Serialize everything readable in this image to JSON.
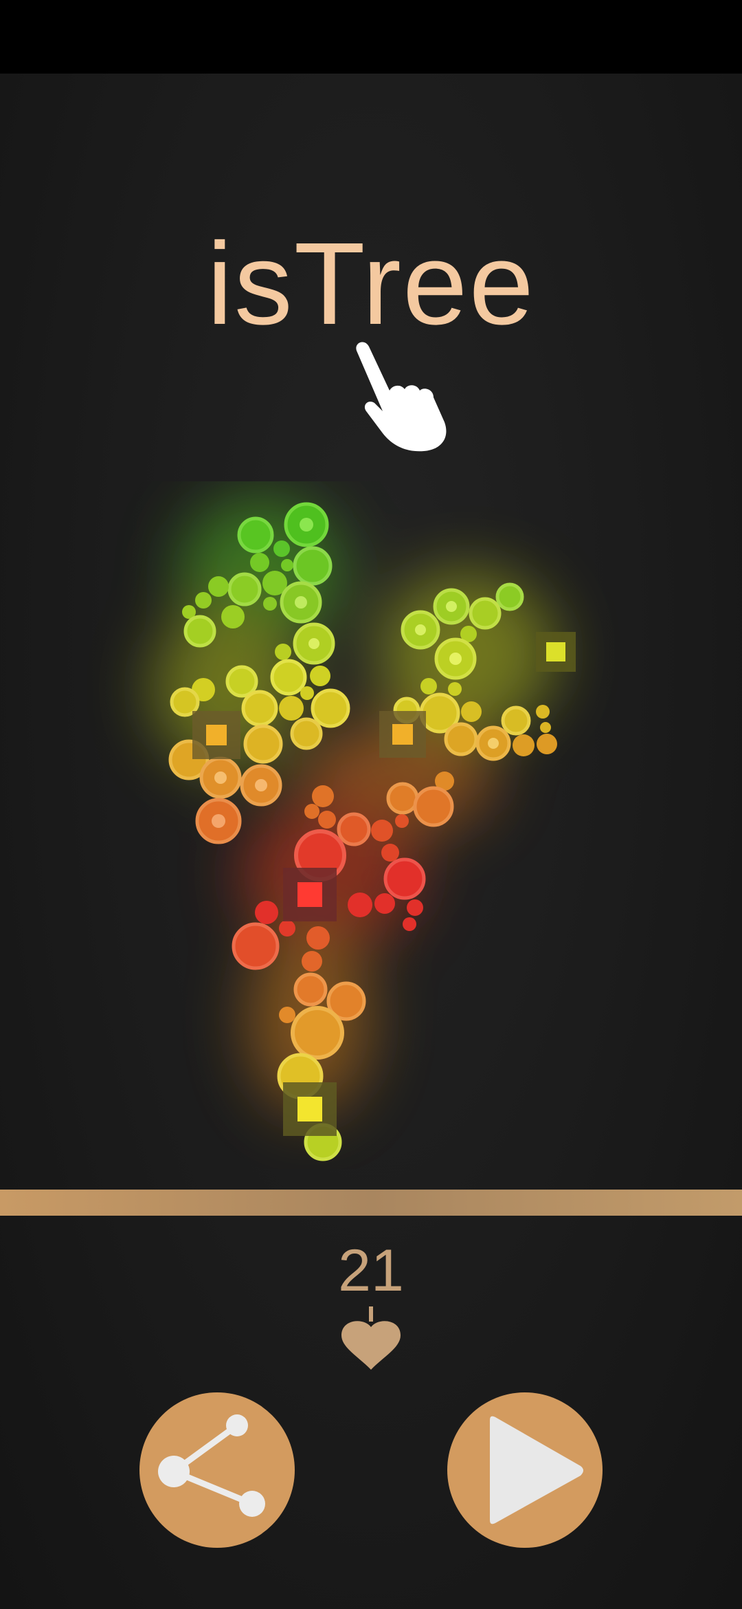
{
  "app": {
    "title": "isTree"
  },
  "score": {
    "value": "21",
    "icon": "leaf-icon"
  },
  "buttons": {
    "share_icon": "share-icon",
    "play_icon": "play-icon"
  },
  "hint": {
    "icon": "tap-hand-icon"
  },
  "colors": {
    "title": "#f4c9a0",
    "accent": "#d39b5f",
    "ground": "#b48b5f",
    "background": "#1b1b1b",
    "green": "#5ccc2c",
    "yellow": "#d9d22a",
    "orange": "#e88e2a",
    "red": "#e8282a"
  }
}
